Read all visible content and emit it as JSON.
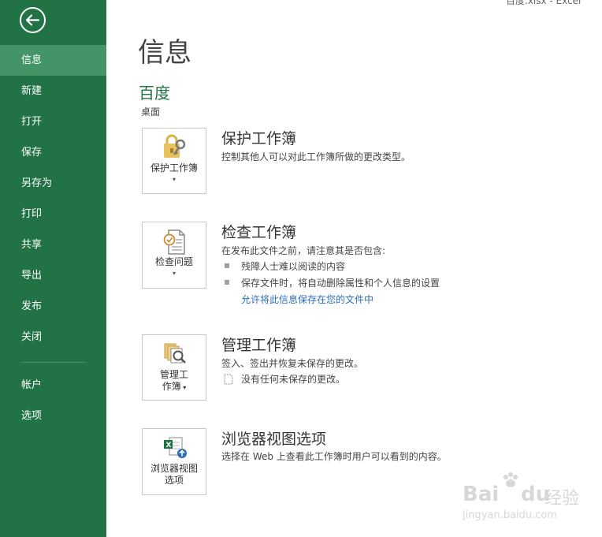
{
  "window": {
    "title": "百度.xlsx - Excel"
  },
  "sidebar": {
    "back_icon": "back-arrow-icon",
    "items": [
      {
        "label": "信息",
        "active": true
      },
      {
        "label": "新建"
      },
      {
        "label": "打开"
      },
      {
        "label": "保存"
      },
      {
        "label": "另存为"
      },
      {
        "label": "打印"
      },
      {
        "label": "共享"
      },
      {
        "label": "导出"
      },
      {
        "label": "发布"
      },
      {
        "label": "关闭"
      }
    ],
    "bottom_items": [
      {
        "label": "帐户"
      },
      {
        "label": "选项"
      }
    ],
    "bg_color": "#217346",
    "active_color": "#439467"
  },
  "main": {
    "title": "信息",
    "doc_name": "百度",
    "doc_location": "桌面",
    "sections": {
      "protect": {
        "tile_label": "保护工作簿",
        "title": "保护工作簿",
        "desc": "控制其他人可以对此工作簿所做的更改类型。",
        "icon": "lock-key-icon"
      },
      "inspect": {
        "tile_label": "检查问题",
        "title": "检查工作簿",
        "desc": "在发布此文件之前，请注意其是否包含:",
        "bullets": [
          "残障人士难以阅读的内容",
          "保存文件时，将自动删除属性和个人信息的设置"
        ],
        "link": "允许将此信息保存在您的文件中",
        "icon": "inspect-document-icon"
      },
      "manage": {
        "tile_label_line1": "管理工",
        "tile_label_line2": "作簿",
        "title": "管理工作簿",
        "desc": "签入、签出并恢复未保存的更改。",
        "note": "没有任何未保存的更改。",
        "icon": "manage-workbook-icon"
      },
      "browser": {
        "tile_label_line1": "浏览器视图",
        "tile_label_line2": "选项",
        "title": "浏览器视图选项",
        "desc": "选择在 Web 上查看此工作簿时用户可以看到的内容。",
        "icon": "browser-view-icon"
      }
    }
  },
  "watermark": {
    "brand": "Bai",
    "brand2": "du",
    "cn": "经验",
    "url": "jingyan.baidu.com"
  }
}
